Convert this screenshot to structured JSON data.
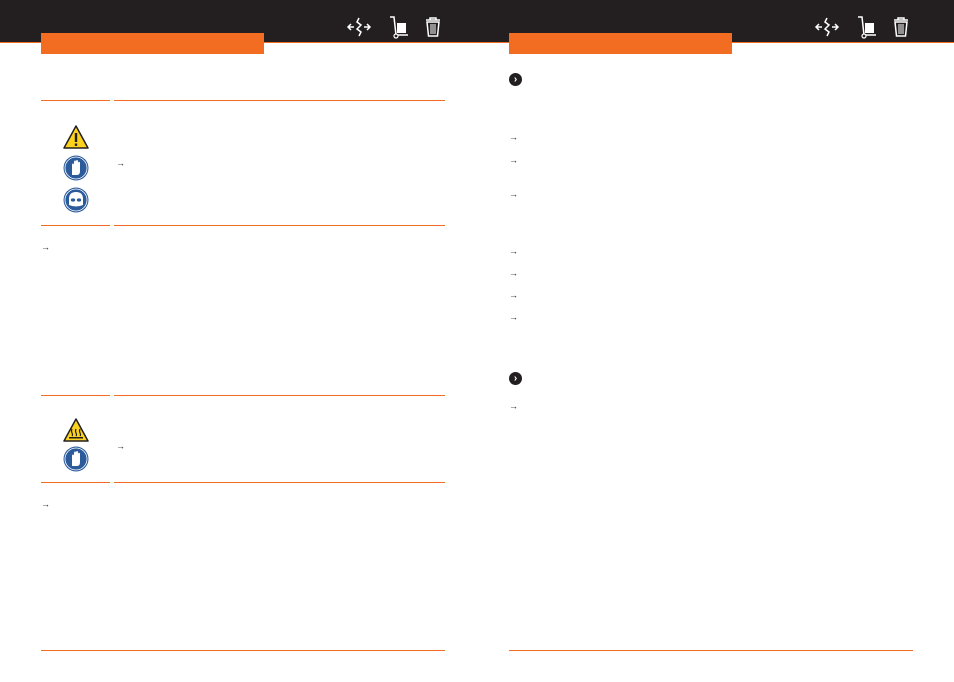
{
  "header": {
    "icons": [
      "assembly-icon",
      "hand-truck-icon",
      "disposal-bin-icon"
    ]
  },
  "left_page": {
    "warning_block_1": {
      "symbols": [
        "warning-triangle-icon",
        "wear-gloves-icon",
        "wear-face-shield-icon"
      ],
      "bullet": "→"
    },
    "paragraph_1": {
      "bullet": "→"
    },
    "warning_block_2": {
      "symbols": [
        "hot-surface-warning-icon",
        "wear-gloves-icon"
      ],
      "bullet": "→"
    },
    "paragraph_2": {
      "bullet": "→"
    }
  },
  "right_page": {
    "step_1": {
      "marker": "›"
    },
    "list_1": {
      "bullets": [
        "→",
        "→",
        "→"
      ]
    },
    "list_2": {
      "bullets": [
        "→",
        "→",
        "→",
        "→"
      ]
    },
    "step_2": {
      "marker": "›"
    },
    "list_3": {
      "bullets": [
        "→"
      ]
    }
  },
  "colors": {
    "accent": "#f26d21",
    "header_bar": "#231f20",
    "safety_blue": "#2c5b9c",
    "warning_yellow": "#fcd21c"
  }
}
